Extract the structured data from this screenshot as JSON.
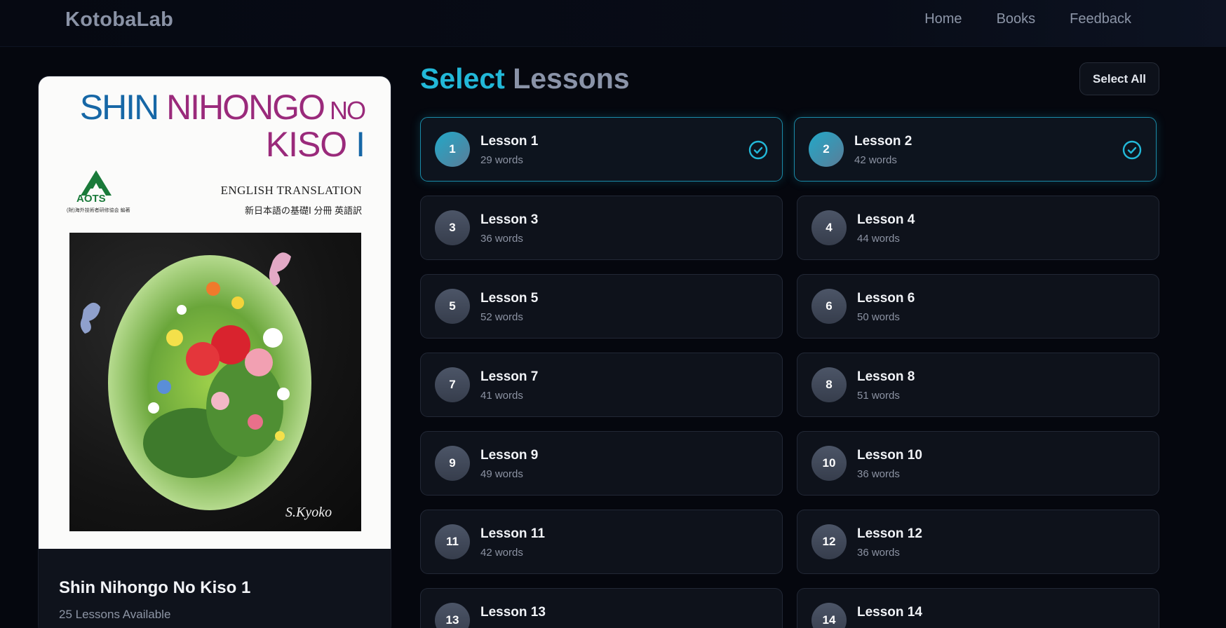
{
  "navbar": {
    "brand": "KotobaLab",
    "links": [
      "Home",
      "Books",
      "Feedback"
    ]
  },
  "book": {
    "cover": {
      "title_line1_a": "SHIN ",
      "title_line1_b": "NIHONGO",
      "title_line1_c": " NO",
      "title_line2_a": "KISO ",
      "title_line2_b": "I",
      "subtitle_en": "ENGLISH TRANSLATION",
      "subtitle_jp": "新日本語の基礎Ⅰ 分冊 英語訳",
      "publisher_logo": "AOTS",
      "publisher_small": "(財)海外技術者研修協会 編著",
      "signature": "S.Kyoko"
    },
    "title": "Shin Nihongo No Kiso 1",
    "lessons_available": "25 Lessons Available"
  },
  "heading": {
    "part1": "Select",
    "part2": " Lessons"
  },
  "select_all_label": "Select All",
  "colors": {
    "accent": "#22b8d8",
    "background": "#05070e",
    "card": "#0e121b"
  },
  "lessons": [
    {
      "number": "1",
      "name": "Lesson 1",
      "words": "29 words",
      "selected": true
    },
    {
      "number": "2",
      "name": "Lesson 2",
      "words": "42 words",
      "selected": true
    },
    {
      "number": "3",
      "name": "Lesson 3",
      "words": "36 words",
      "selected": false
    },
    {
      "number": "4",
      "name": "Lesson 4",
      "words": "44 words",
      "selected": false
    },
    {
      "number": "5",
      "name": "Lesson 5",
      "words": "52 words",
      "selected": false
    },
    {
      "number": "6",
      "name": "Lesson 6",
      "words": "50 words",
      "selected": false
    },
    {
      "number": "7",
      "name": "Lesson 7",
      "words": "41 words",
      "selected": false
    },
    {
      "number": "8",
      "name": "Lesson 8",
      "words": "51 words",
      "selected": false
    },
    {
      "number": "9",
      "name": "Lesson 9",
      "words": "49 words",
      "selected": false
    },
    {
      "number": "10",
      "name": "Lesson 10",
      "words": "36 words",
      "selected": false
    },
    {
      "number": "11",
      "name": "Lesson 11",
      "words": "42 words",
      "selected": false
    },
    {
      "number": "12",
      "name": "Lesson 12",
      "words": "36 words",
      "selected": false
    },
    {
      "number": "13",
      "name": "Lesson 13",
      "words": "",
      "selected": false
    },
    {
      "number": "14",
      "name": "Lesson 14",
      "words": "",
      "selected": false
    }
  ]
}
